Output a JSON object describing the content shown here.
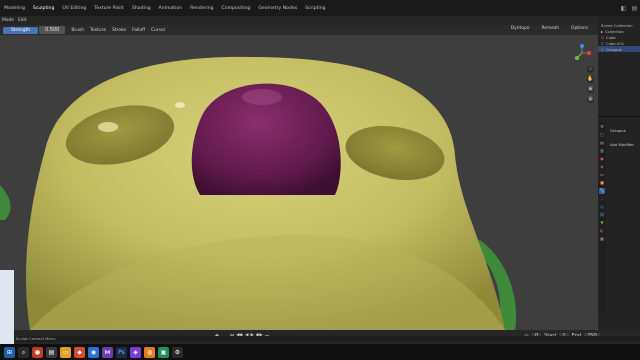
{
  "workspace_tabs": [
    "Modeling",
    "Sculpting",
    "UV Editing",
    "Texture Paint",
    "Shading",
    "Animation",
    "Rendering",
    "Compositing",
    "Geometry Nodes",
    "Scripting"
  ],
  "active_tab_index": 1,
  "header": {
    "mode_label": "Mode",
    "edit_label": "Edit"
  },
  "toolbar": {
    "strength_label": "Strength",
    "strength_value": "0.500",
    "brush_label": "Brush",
    "texture_label": "Texture",
    "stroke_label": "Stroke",
    "falloff_label": "Falloff",
    "cursor_label": "Cursor",
    "overlays_label": "Dyntopo",
    "remesh_label": "Remesh",
    "options_label": "Options"
  },
  "outliner": {
    "title": "Scene Collection",
    "items": [
      "Collection",
      "Cube",
      "Cube.001",
      "Octopus"
    ]
  },
  "properties": {
    "object_name": "Octopus",
    "add_modifier_label": "Add Modifier"
  },
  "timeline": {
    "start_label": "Start",
    "start_value": "1",
    "end_label": "End",
    "end_value": "250",
    "current_frame": "0"
  },
  "status_bar": {
    "text": "Sculpt Context Menu"
  },
  "colors": {
    "body": "#c9c46a",
    "nose": "#6e2055",
    "accent": "#4a74b8",
    "background": "#3e3e3e"
  }
}
